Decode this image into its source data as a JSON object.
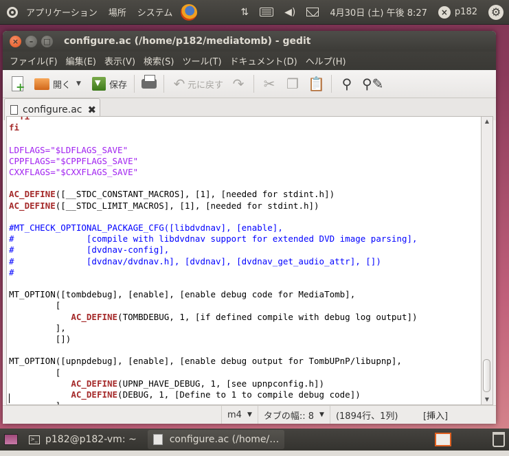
{
  "top_panel": {
    "menu": [
      "アプリケーション",
      "場所",
      "システム"
    ],
    "clock": "4月30日 (土) 午後 8:27",
    "user": "p182"
  },
  "window": {
    "title": "configure.ac (/home/p182/mediatomb) - gedit",
    "menu": [
      "ファイル(F)",
      "編集(E)",
      "表示(V)",
      "検索(S)",
      "ツール(T)",
      "ドキュメント(D)",
      "ヘルプ(H)"
    ],
    "toolbar": {
      "open_label": "開く",
      "save_label": "保存",
      "undo_label": "元に戻す"
    },
    "tab": {
      "label": "configure.ac"
    }
  },
  "editor": {
    "lines": [
      [
        {
          "t": "  fi",
          "c": "kw"
        }
      ],
      [
        {
          "t": "fi",
          "c": "kw"
        }
      ],
      [
        {
          "t": ""
        }
      ],
      [
        {
          "t": "LDFLAGS=\"$LDFLAGS_SAVE\"",
          "c": "var"
        }
      ],
      [
        {
          "t": "CPPFLAGS=\"$CPPFLAGS_SAVE\"",
          "c": "var"
        }
      ],
      [
        {
          "t": "CXXFLAGS=\"$CXXFLAGS_SAVE\"",
          "c": "var"
        }
      ],
      [
        {
          "t": ""
        }
      ],
      [
        {
          "t": "AC_DEFINE",
          "c": "kw"
        },
        {
          "t": "([__STDC_CONSTANT_MACROS], [1], [needed for stdint.h])"
        }
      ],
      [
        {
          "t": "AC_DEFINE",
          "c": "kw"
        },
        {
          "t": "([__STDC_LIMIT_MACROS], [1], [needed for stdint.h])"
        }
      ],
      [
        {
          "t": ""
        }
      ],
      [
        {
          "t": "#MT_CHECK_OPTIONAL_PACKAGE_CFG([libdvdnav], [enable],",
          "c": "cmt"
        }
      ],
      [
        {
          "t": "#              [compile with libdvdnav support for extended DVD image parsing],",
          "c": "cmt"
        }
      ],
      [
        {
          "t": "#              [dvdnav-config],",
          "c": "cmt"
        }
      ],
      [
        {
          "t": "#              [dvdnav/dvdnav.h], [dvdnav], [dvdnav_get_audio_attr], [])",
          "c": "cmt"
        }
      ],
      [
        {
          "t": "#",
          "c": "cmt"
        }
      ],
      [
        {
          "t": ""
        }
      ],
      [
        {
          "t": "MT_OPTION([tombdebug], [enable], [enable debug code for MediaTomb],"
        }
      ],
      [
        {
          "t": "         ["
        }
      ],
      [
        {
          "t": "            "
        },
        {
          "t": "AC_DEFINE",
          "c": "kw"
        },
        {
          "t": "(TOMBDEBUG, 1, [if defined compile with debug log output])"
        }
      ],
      [
        {
          "t": "         ],"
        }
      ],
      [
        {
          "t": "         [])"
        }
      ],
      [
        {
          "t": ""
        }
      ],
      [
        {
          "t": "MT_OPTION([upnpdebug], [enable], [enable debug output for TombUPnP/libupnp],"
        }
      ],
      [
        {
          "t": "         ["
        }
      ],
      [
        {
          "t": "            "
        },
        {
          "t": "AC_DEFINE",
          "c": "kw"
        },
        {
          "t": "(UPNP_HAVE_DEBUG, 1, [see upnpconfig.h])"
        }
      ],
      [
        {
          "t": "            "
        },
        {
          "t": "AC_DEFINE",
          "c": "kw"
        },
        {
          "t": "(DEBUG, 1, [Define to 1 to compile debug code])"
        }
      ],
      [
        {
          "t": "         ],"
        }
      ]
    ]
  },
  "statusbar": {
    "language": "m4",
    "tab_width": "タブの幅:: 8",
    "position": "(1894行、1列)",
    "mode": "[挿入]"
  },
  "bottom_panel": {
    "tasks": [
      {
        "label": "p182@p182-vm: ~"
      },
      {
        "label": "configure.ac (/home/…"
      }
    ]
  },
  "colors": {
    "keyword": "#a52a2a",
    "variable": "#a020f0",
    "comment": "#0000ff",
    "close_button": "#e2541e"
  }
}
